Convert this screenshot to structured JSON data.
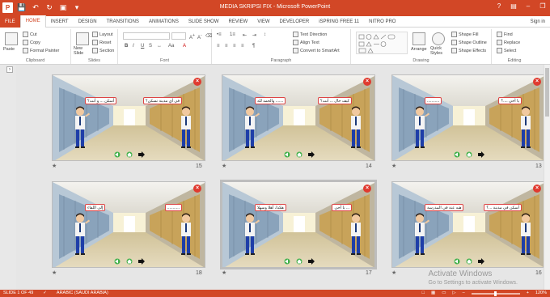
{
  "window": {
    "title": "MEDIA SKRIPSI FIX - Microsoft PowerPoint",
    "app_icon": "P"
  },
  "tabs": [
    {
      "label": "FILE"
    },
    {
      "label": "HOME"
    },
    {
      "label": "INSERT"
    },
    {
      "label": "DESIGN"
    },
    {
      "label": "TRANSITIONS"
    },
    {
      "label": "ANIMATIONS"
    },
    {
      "label": "SLIDE SHOW"
    },
    {
      "label": "REVIEW"
    },
    {
      "label": "VIEW"
    },
    {
      "label": "DEVELOPER"
    },
    {
      "label": "iSPRING FREE 11"
    },
    {
      "label": "NITRO PRO"
    }
  ],
  "signin": "Sign in",
  "ribbon": {
    "clipboard": {
      "label": "Clipboard",
      "paste": "Paste",
      "cut": "Cut",
      "copy": "Copy",
      "format_painter": "Format Painter"
    },
    "slides": {
      "label": "Slides",
      "new_slide": "New Slide",
      "layout": "Layout",
      "reset": "Reset",
      "section": "Section"
    },
    "font": {
      "label": "Font"
    },
    "paragraph": {
      "label": "Paragraph",
      "text_direction": "Text Direction",
      "align_text": "Align Text",
      "convert_smartart": "Convert to SmartArt"
    },
    "drawing": {
      "label": "Drawing",
      "arrange": "Arrange",
      "quick_styles": "Quick Styles",
      "shape_fill": "Shape Fill",
      "shape_outline": "Shape Outline",
      "shape_effects": "Shape Effects"
    },
    "editing": {
      "label": "Editing",
      "find": "Find",
      "replace": "Replace",
      "select": "Select"
    }
  },
  "slides": [
    {
      "number": "15",
      "left_bubble": "أسكن ... و أنت؟",
      "right_bubble": "في أي مدينة تسكن؟"
    },
    {
      "number": "14",
      "left_bubble": "....... والحمد لله",
      "right_bubble": "كيف حال ... أنت؟"
    },
    {
      "number": "13",
      "left_bubble": "...........",
      "right_bubble": "يا أخي ....؟"
    },
    {
      "number": "18",
      "left_bubble": "إلى اللقاء",
      "right_bubble": "..........."
    },
    {
      "number": "17",
      "left_bubble": "هكذا، أهلا وسهلا",
      "right_bubble": "... يا أخي"
    },
    {
      "number": "16",
      "left_bubble": "هيه عنة في المدرسة",
      "right_bubble": "أسكن في مدينة ...؟"
    }
  ],
  "watermark": {
    "line1": "Activate Windows",
    "line2": "Go to Settings to activate Windows."
  },
  "status": {
    "slide": "SLIDE 1 OF 49",
    "language": "ARABIC (SAUDI ARABIA)",
    "zoom": "120%"
  },
  "colors": {
    "accent": "#d24726"
  }
}
